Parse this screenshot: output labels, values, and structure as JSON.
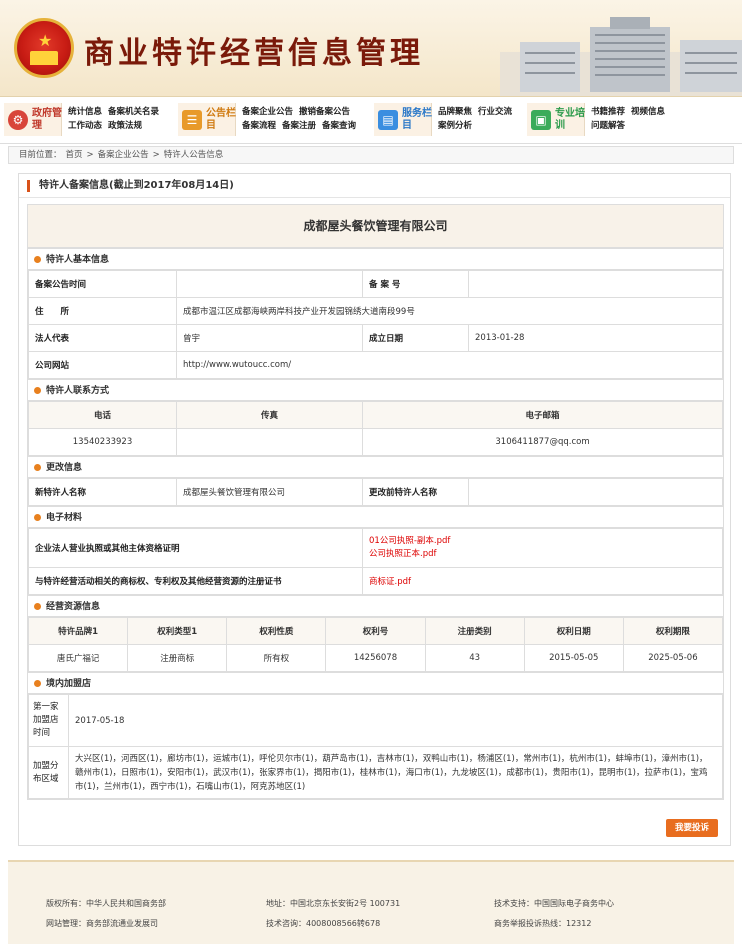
{
  "header": {
    "title": "商业特许经营信息管理"
  },
  "nav": [
    {
      "icon": "gov-icon",
      "color": "#d8453a",
      "label": "政府管理",
      "links": [
        "统计信息",
        "备案机关名录",
        "工作动态",
        "政策法规"
      ]
    },
    {
      "icon": "notice-icon",
      "color": "#e89a2a",
      "label": "公告栏目",
      "links": [
        "备案企业公告",
        "撤销备案公告",
        "备案流程",
        "备案注册",
        "备案查询"
      ]
    },
    {
      "icon": "service-icon",
      "color": "#3a8ee0",
      "label": "服务栏目",
      "links": [
        "品牌聚焦",
        "行业交流",
        "案例分析"
      ]
    },
    {
      "icon": "training-icon",
      "color": "#3aab5a",
      "label": "专业培训",
      "links": [
        "书籍推荐",
        "视频信息",
        "问题解答"
      ]
    }
  ],
  "breadcrumb": {
    "prefix": "目前位置：",
    "items": [
      "首页",
      "备案企业公告",
      "特许人公告信息"
    ],
    "sep": ">"
  },
  "panel": {
    "heading": "特许人备案信息(截止到2017年08月14日)"
  },
  "company": {
    "name": "成都屋头餐饮管理有限公司"
  },
  "basic": {
    "title": "特许人基本信息",
    "notice_time_label": "备案公告时间",
    "notice_time_value": "",
    "record_no_label": "备 案 号",
    "record_no_value": "",
    "address_label": "住　　所",
    "address_value": "成都市温江区成都海峡两岸科技产业开发园锦绣大道南段99号",
    "legal_label": "法人代表",
    "legal_value": "曾宇",
    "founded_label": "成立日期",
    "founded_value": "2013-01-28",
    "website_label": "公司网站",
    "website_value": "http://www.wutoucc.com/"
  },
  "contact": {
    "title": "特许人联系方式",
    "phone_label": "电话",
    "fax_label": "传真",
    "email_label": "电子邮箱",
    "phone_value": "13540233923",
    "fax_value": "",
    "email_value": "3106411877@qq.com"
  },
  "change": {
    "title": "更改信息",
    "new_label": "新特许人名称",
    "new_value": "成都屋头餐饮管理有限公司",
    "old_label": "更改前特许人名称",
    "old_value": ""
  },
  "materials": {
    "title": "电子材料",
    "license_label": "企业法人营业执照或其他主体资格证明",
    "license_files": [
      "01公司执照-副本.pdf",
      "公司执照正本.pdf"
    ],
    "trademark_label": "与特许经营活动相关的商标权、专利权及其他经营资源的注册证书",
    "trademark_files": [
      "商标证.pdf"
    ]
  },
  "resources": {
    "title": "经营资源信息",
    "headers": [
      "特许品牌1",
      "权利类型1",
      "权利性质",
      "权利号",
      "注册类别",
      "权利日期",
      "权利期限"
    ],
    "rows": [
      [
        "唐氏广福记",
        "注册商标",
        "所有权",
        "14256078",
        "43",
        "2015-05-05",
        "2025-05-06"
      ]
    ]
  },
  "stores": {
    "title": "境内加盟店",
    "first_label": "第一家加盟店时间",
    "first_value": "2017-05-18",
    "region_label": "加盟分布区域",
    "region_value": "大兴区(1)，河西区(1)，廊坊市(1)，运城市(1)，呼伦贝尔市(1)，葫芦岛市(1)，吉林市(1)，双鸭山市(1)，杨浦区(1)，常州市(1)，杭州市(1)，蚌埠市(1)，漳州市(1)，赣州市(1)，日照市(1)，安阳市(1)，武汉市(1)，张家界市(1)，揭阳市(1)，桂林市(1)，海口市(1)，九龙坡区(1)，成都市(1)，贵阳市(1)，昆明市(1)，拉萨市(1)，宝鸡市(1)，兰州市(1)，西宁市(1)，石嘴山市(1)，阿克苏地区(1)"
  },
  "complaint_button": "我要投诉",
  "footer": {
    "copyright": "版权所有：中华人民共和国商务部",
    "address": "地址：中国北京东长安街2号 100731",
    "tech_support": "技术支持：中国国际电子商务中心",
    "operator": "网站管理：商务部流通业发展司",
    "hotline": "技术咨询：4008008566转678",
    "report": "商务举报投诉热线：12312"
  }
}
